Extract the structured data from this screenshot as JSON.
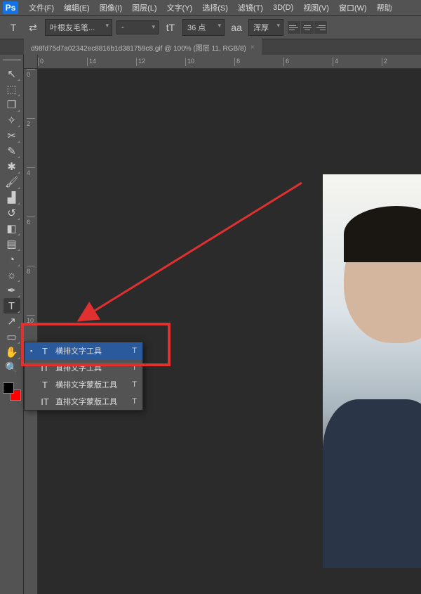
{
  "menu": {
    "items": [
      "文件(F)",
      "编辑(E)",
      "图像(I)",
      "图层(L)",
      "文字(Y)",
      "选择(S)",
      "滤镜(T)",
      "3D(D)",
      "视图(V)",
      "窗口(W)",
      "帮助"
    ]
  },
  "options": {
    "tool_glyph": "T",
    "font_family": "叶根友毛笔...",
    "font_style": "-",
    "size_icon": "tT",
    "font_size": "36 点",
    "aa_icon": "aa",
    "antialias": "浑厚"
  },
  "document": {
    "tab_title": "d98fd75d7a02342ec8816b1d381759c8.gif @ 100% (图层 11, RGB/8)",
    "close_glyph": "×"
  },
  "ruler_h_ticks": [
    "0",
    "14",
    "12",
    "10",
    "8",
    "6",
    "4",
    "2"
  ],
  "ruler_v_ticks": [
    "0",
    "2",
    "4",
    "6",
    "8",
    "10"
  ],
  "tools": [
    {
      "name": "move",
      "glyph": "↖",
      "corner": true
    },
    {
      "name": "marquee",
      "glyph": "⬚",
      "corner": true
    },
    {
      "name": "lasso",
      "glyph": "❐",
      "corner": true
    },
    {
      "name": "wand",
      "glyph": "✧",
      "corner": true
    },
    {
      "name": "crop",
      "glyph": "✂",
      "corner": true
    },
    {
      "name": "eyedropper",
      "glyph": "✎",
      "corner": true
    },
    {
      "name": "heal",
      "glyph": "✱",
      "corner": true
    },
    {
      "name": "brush",
      "glyph": "🖌",
      "corner": true
    },
    {
      "name": "stamp",
      "glyph": "▟",
      "corner": true
    },
    {
      "name": "history",
      "glyph": "↺",
      "corner": true
    },
    {
      "name": "eraser",
      "glyph": "◧",
      "corner": true
    },
    {
      "name": "gradient",
      "glyph": "▤",
      "corner": true
    },
    {
      "name": "blur",
      "glyph": "◔",
      "corner": true
    },
    {
      "name": "dodge",
      "glyph": "☼",
      "corner": true
    },
    {
      "name": "pen",
      "glyph": "✒",
      "corner": true
    },
    {
      "name": "type",
      "glyph": "T",
      "corner": true,
      "active": true
    },
    {
      "name": "path",
      "glyph": "↗",
      "corner": true
    },
    {
      "name": "shape",
      "glyph": "▭",
      "corner": true
    },
    {
      "name": "hand",
      "glyph": "✋",
      "corner": true
    },
    {
      "name": "zoom",
      "glyph": "🔍",
      "corner": false
    }
  ],
  "flyout": {
    "items": [
      {
        "icon": "T",
        "label": "横排文字工具",
        "key": "T",
        "selected": true,
        "indicator": "▪"
      },
      {
        "icon": "IT",
        "label": "直排文字工具",
        "key": "T",
        "selected": false,
        "indicator": ""
      },
      {
        "icon": "T",
        "label": "横排文字蒙版工具",
        "key": "T",
        "selected": false,
        "indicator": ""
      },
      {
        "icon": "IT",
        "label": "直排文字蒙版工具",
        "key": "T",
        "selected": false,
        "indicator": ""
      }
    ]
  }
}
